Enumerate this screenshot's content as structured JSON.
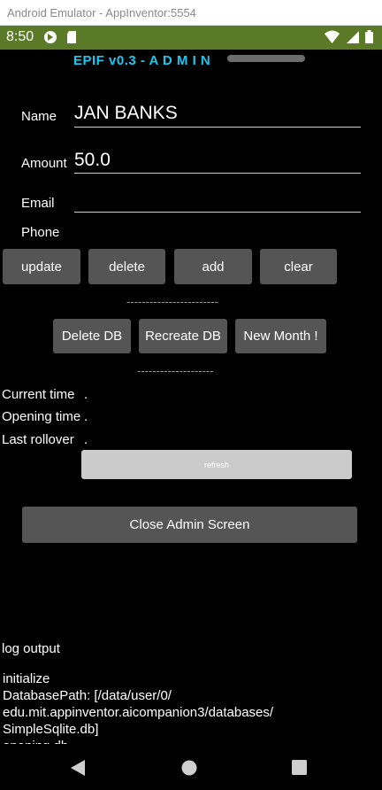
{
  "window": {
    "title": "Android Emulator - AppInventor:5554"
  },
  "statusbar": {
    "time": "8:50"
  },
  "app": {
    "title": "EPIF v0.3 - A D M I N"
  },
  "form": {
    "name_label": "Name",
    "name_value": "JAN BANKS",
    "amount_label": "Amount",
    "amount_value": "50.0",
    "email_label": "Email",
    "email_value": "",
    "phone_label": "Phone"
  },
  "actions": {
    "update": "update",
    "delete": "delete",
    "add": "add",
    "clear": "clear"
  },
  "separator_1": "------------------------",
  "db_actions": {
    "delete_db": "Delete DB",
    "recreate_db": "Recreate DB",
    "new_month": "New Month !"
  },
  "separator_2": "--------------------",
  "times": {
    "current_label": "Current time",
    "current_value": ".",
    "opening_label": "Opening time",
    "opening_value": ".",
    "rollover_label": "Last rollover",
    "rollover_value": "."
  },
  "refresh_label": "refresh",
  "close_label": "Close Admin Screen",
  "log": {
    "label": "log output",
    "text": "initialize\nDatabasePath: [/data/user/0/\nedu.mit.appinventor.aicompanion3/databases/\nSimpleSqlite.db]\nopening db"
  },
  "colors": {
    "accent": "#19c9f0",
    "statusbar": "#5b7a28",
    "button": "#555555",
    "background": "#000000"
  }
}
